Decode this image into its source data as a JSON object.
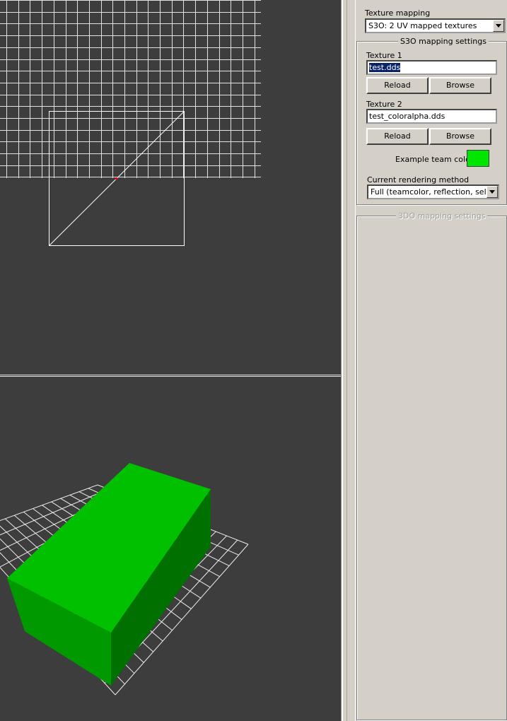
{
  "panel": {
    "texture_mapping_label": "Texture mapping",
    "texture_mapping_value": "S3O: 2 UV mapped textures",
    "s3o_group_title": "S3O mapping settings",
    "texture1_label": "Texture 1",
    "texture1_value": "test.dds",
    "texture2_label": "Texture 2",
    "texture2_value": "test_coloralpha.dds",
    "reload_label": "Reload",
    "browse_label": "Browse",
    "team_color_label": "Example team color:",
    "team_color": "#00e600",
    "rendering_method_label": "Current rendering method",
    "rendering_method_value": "Full (teamcolor, reflection, self-illumination)",
    "tdo_group_title": "3DO mapping settings"
  },
  "colors": {
    "viewport_bg": "#3d3d3d",
    "grid": "#ffffff",
    "model_top": "#00c000",
    "model_front": "#009a00",
    "model_side": "#007400",
    "center_marker": "#ff0000"
  }
}
